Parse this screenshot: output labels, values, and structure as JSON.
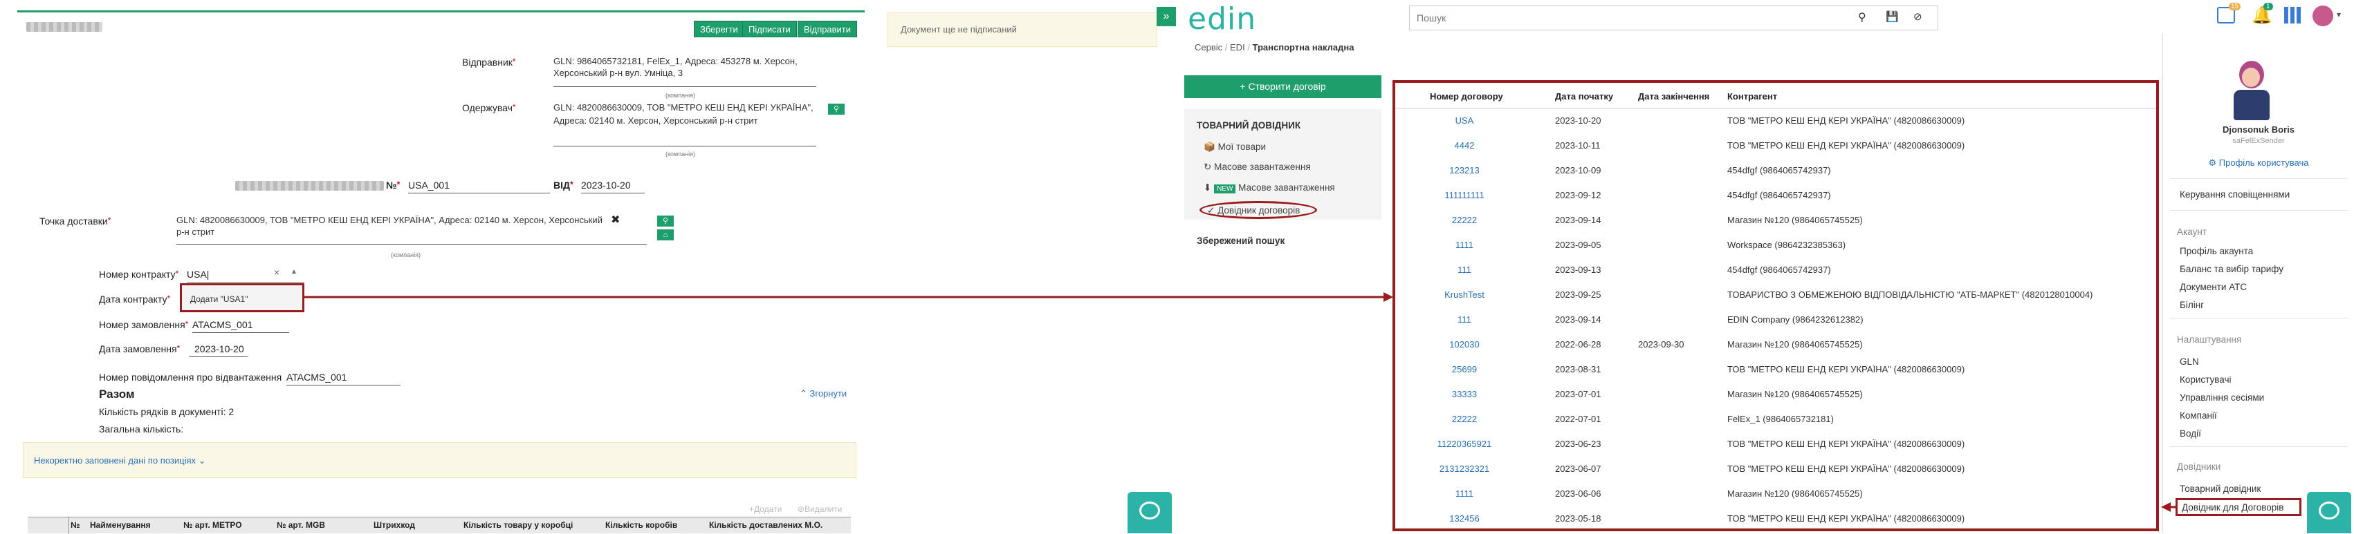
{
  "left": {
    "buttons": {
      "save": "Зберегти",
      "sign": "Підписати",
      "send": "Відправити"
    },
    "sender": {
      "label": "Відправник",
      "value": "GLN: 9864065732181, FelEx_1, Адреса: 453278 м. Херсон, Херсонський р-н вул. Умніца, 3",
      "under": "(компанія)"
    },
    "receiver": {
      "label": "Одержувач",
      "value": "GLN: 4820086630009, ТОВ \"МЕТРО КЕШ ЕНД КЕРІ УКРАЇНА\", Адреса: 02140 м. Херсон, Херсонський р-н стрит",
      "under": "(компанія)"
    },
    "doc_number": {
      "prefix": "№",
      "value": "USA_001",
      "date_label": "ВІД",
      "date_value": "2023-10-20"
    },
    "delivery_point": {
      "label": "Точка доставки",
      "value": "GLN: 4820086630009, ТОВ \"МЕТРО КЕШ ЕНД КЕРІ УКРАЇНА\", Адреса: 02140 м. Херсон, Херсонський р-н стрит",
      "under": "(компанія)"
    },
    "contract_number": {
      "label": "Номер контракту",
      "value": "USA|"
    },
    "contract_date": {
      "label": "Дата контракту"
    },
    "popup": {
      "text": "Додати \"USA1\""
    },
    "order_number": {
      "label": "Номер замовлення",
      "value": "ATACMS_001"
    },
    "order_date": {
      "label": "Дата замовлення",
      "value": "2023-10-20"
    },
    "shipment_notice": {
      "label": "Номер повідомлення про відвантаження",
      "value": "ATACMS_001"
    },
    "total": {
      "title": "Разом",
      "collapse": "Згорнути",
      "rows_label": "Кількість рядків в документі:",
      "rows_value": "2",
      "qty_label": "Загальна кількість:"
    },
    "incomplete": "Некоректно заповнені дані по позиціях",
    "table_actions": {
      "add": "Додати",
      "delete": "Видалити"
    },
    "table_headers": [
      "№",
      "Найменування",
      "№ арт. МЕТРО",
      "№ арт. MGB",
      "Штрихкод",
      "Кількість товару у коробці",
      "Кількість коробів",
      "Кількість доставлених М.О."
    ],
    "status_note": "Документ ще не підписаний"
  },
  "right": {
    "brand": "edin",
    "search_placeholder": "Пошук",
    "badges": {
      "calendar": "15",
      "bell": "1"
    },
    "breadcrumb": [
      "Сервіс",
      "EDI",
      "Транспортна накладна"
    ],
    "create_button": "Створити договір",
    "menu": {
      "section": "ТОВАРНИЙ ДОВІДНИК",
      "items": [
        "Мої товари",
        "Масове завантаження",
        "Масове завантаження",
        "Довідник договорів"
      ],
      "new_badge": "NEW",
      "saved_search": "Збережений пошук"
    },
    "contracts_table": {
      "headers": [
        "Номер договору",
        "Дата початку",
        "Дата закінчення",
        "Контрагент"
      ],
      "rows": [
        [
          "USA",
          "2023-10-20",
          "",
          "ТОВ \"МЕТРО КЕШ ЕНД КЕРІ УКРАЇНА\" (4820086630009)"
        ],
        [
          "4442",
          "2023-10-11",
          "",
          "ТОВ \"МЕТРО КЕШ ЕНД КЕРІ УКРАЇНА\" (4820086630009)"
        ],
        [
          "123213",
          "2023-10-09",
          "",
          "454dfgf (9864065742937)"
        ],
        [
          "111111111",
          "2023-09-12",
          "",
          "454dfgf (9864065742937)"
        ],
        [
          "22222",
          "2023-09-14",
          "",
          "Магазин №120 (9864065745525)"
        ],
        [
          "1111",
          "2023-09-05",
          "",
          "Workspace (9864232385363)"
        ],
        [
          "111",
          "2023-09-13",
          "",
          "454dfgf (9864065742937)"
        ],
        [
          "KrushTest",
          "2023-09-25",
          "",
          "ТОВАРИСТВО З ОБМЕЖЕНОЮ ВІДПОВІДАЛЬНІСТЮ \"АТБ-МАРКЕТ\" (4820128010004)"
        ],
        [
          "111",
          "2023-09-14",
          "",
          "EDIN Company (9864232612382)"
        ],
        [
          "102030",
          "2022-06-28",
          "2023-09-30",
          "Магазин №120 (9864065745525)"
        ],
        [
          "25699",
          "2023-08-31",
          "",
          "ТОВ \"МЕТРО КЕШ ЕНД КЕРІ УКРАЇНА\" (4820086630009)"
        ],
        [
          "33333",
          "2023-07-01",
          "",
          "Магазин №120 (9864065745525)"
        ],
        [
          "22222",
          "2022-07-01",
          "",
          "FelEx_1 (9864065732181)"
        ],
        [
          "11220365921",
          "2023-06-23",
          "",
          "ТОВ \"МЕТРО КЕШ ЕНД КЕРІ УКРАЇНА\" (4820086630009)"
        ],
        [
          "2131232321",
          "2023-06-07",
          "",
          "ТОВ \"МЕТРО КЕШ ЕНД КЕРІ УКРАЇНА\" (4820086630009)"
        ],
        [
          "1111",
          "2023-06-06",
          "",
          "Магазин №120 (9864065745525)"
        ],
        [
          "132456",
          "2023-05-18",
          "",
          "ТОВ \"МЕТРО КЕШ ЕНД КЕРІ УКРАЇНА\" (4820086630009)"
        ]
      ]
    },
    "user": {
      "name": "Djonsonuk Boris",
      "company": "saFelExSender",
      "profile_link": "Профіль користувача"
    },
    "user_menu": {
      "notifications": "Керування сповіщеннями",
      "account_header": "Акаунт",
      "account_items": [
        "Профіль акаунта",
        "Баланс та вибір тарифу",
        "Документи АТС",
        "Білінг"
      ],
      "settings_header": "Налаштування",
      "settings_items": [
        "GLN",
        "Користувачі",
        "Управління сесіями",
        "Компанії",
        "Водії"
      ],
      "directories_header": "Довідники",
      "directories_items": [
        "Товарний довідник",
        "Довідник для Договорів"
      ]
    },
    "colors": {
      "accent_green": "#1e9e6a",
      "highlight_red": "#9b1c1c",
      "brand_teal": "#2ab3a6"
    }
  }
}
